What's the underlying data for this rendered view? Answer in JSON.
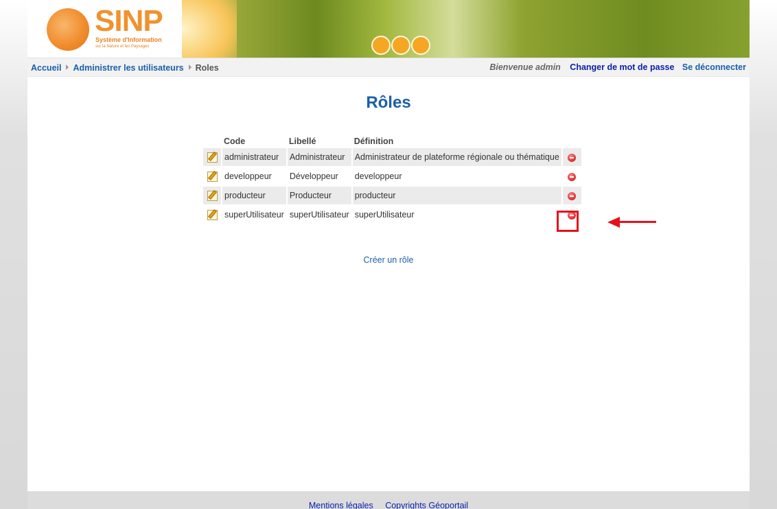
{
  "header": {
    "logo_title": "SINP",
    "logo_subtitle": "Système d'Information",
    "logo_subtitle2": "sur la Nature et les Paysages"
  },
  "breadcrumb": {
    "items": [
      "Accueil",
      "Administrer les utilisateurs"
    ],
    "current": "Roles"
  },
  "user": {
    "welcome": "Bienvenue admin",
    "change_password": "Changer de mot de passe",
    "logout": "Se déconnecter"
  },
  "page_title": "Rôles",
  "table": {
    "headers": [
      "Code",
      "Libellé",
      "Définition"
    ],
    "rows": [
      {
        "code": "administrateur",
        "label": "Administrateur",
        "definition": "Administrateur de plateforme régionale ou thématique"
      },
      {
        "code": "developpeur",
        "label": "Développeur",
        "definition": "developpeur"
      },
      {
        "code": "producteur",
        "label": "Producteur",
        "definition": "producteur"
      },
      {
        "code": "superUtilisateur",
        "label": "superUtilisateur",
        "definition": "superUtilisateur"
      }
    ]
  },
  "actions": {
    "create_role": "Créer un rôle"
  },
  "footer": {
    "legal": "Mentions légales",
    "copyrights": "Copyrights Géoportail"
  },
  "icons": {
    "edit": "edit-pencil-icon",
    "delete": "delete-minus-icon"
  },
  "colors": {
    "accent": "#1a5fa8",
    "highlight": "#e8101a",
    "logo_orange": "#f0922e"
  }
}
